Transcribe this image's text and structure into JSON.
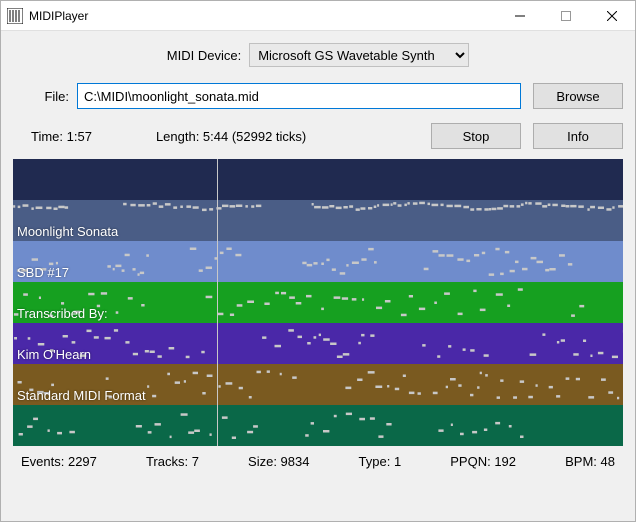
{
  "window": {
    "title": "MIDIPlayer"
  },
  "device": {
    "label": "MIDI Device:",
    "selected": "Microsoft GS Wavetable Synth"
  },
  "file": {
    "label": "File:",
    "value": "C:\\MIDI\\moonlight_sonata.mid",
    "browse_label": "Browse"
  },
  "playback": {
    "time_label": "Time: 1:57",
    "length_label": "Length: 5:44 (52992 ticks)",
    "stop_label": "Stop",
    "info_label": "Info",
    "playhead_percent": 33.5
  },
  "tracks": [
    {
      "label": "",
      "color": "#202a50"
    },
    {
      "label": "Moonlight Sonata",
      "color": "#4a5d86"
    },
    {
      "label": "SBD #17",
      "color": "#6f8ccc"
    },
    {
      "label": "Transcribed By:",
      "color": "#16a020"
    },
    {
      "label": "Kim O'Hearn",
      "color": "#4a28a8"
    },
    {
      "label": "Standard MIDI Format",
      "color": "#7a5a20"
    },
    {
      "label": "",
      "color": "#0a6848"
    }
  ],
  "status": {
    "events": "Events: 2297",
    "tracks": "Tracks: 7",
    "size": "Size: 9834",
    "type": "Type: 1",
    "ppqn": "PPQN: 192",
    "bpm": "BPM: 48"
  }
}
